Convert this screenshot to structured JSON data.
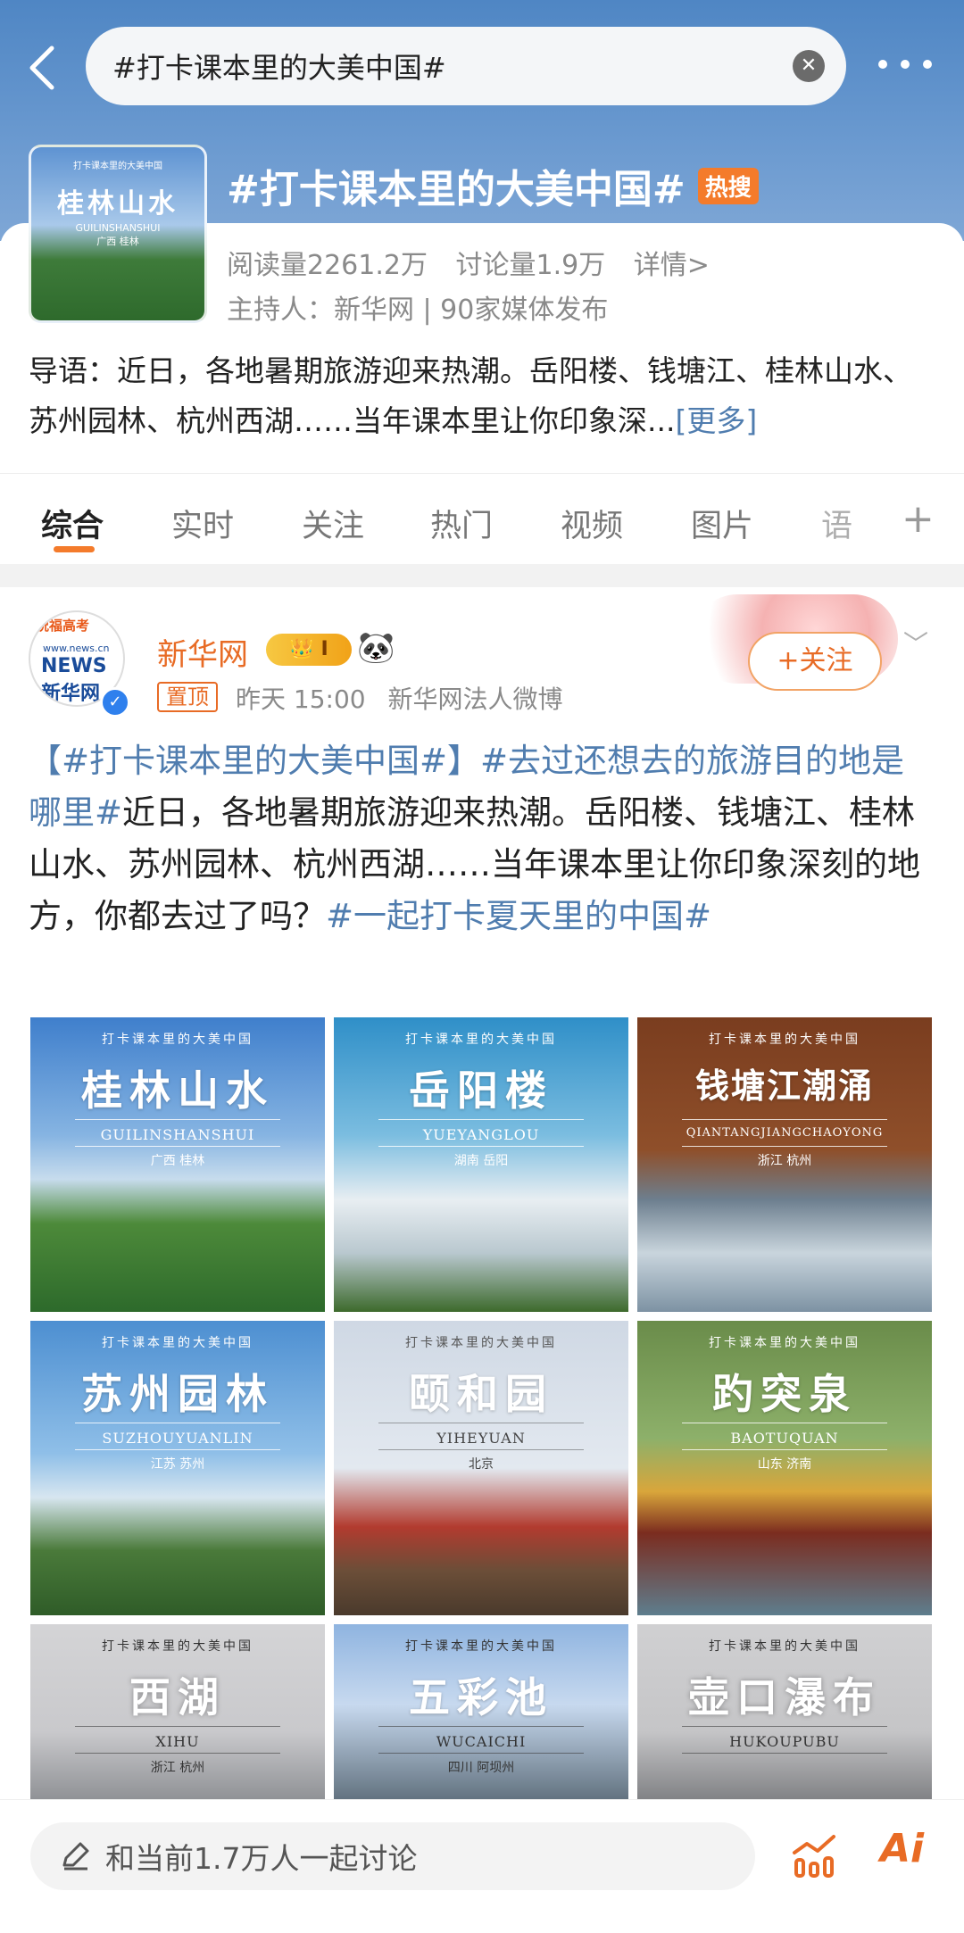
{
  "search": {
    "query": "#打卡课本里的大美中国#"
  },
  "topic": {
    "title": "#打卡课本里的大美中国#",
    "hot_badge": "热搜",
    "reads": "阅读量2261.2万",
    "discussions": "讨论量1.9万",
    "details": "详情>",
    "host": "主持人：新华网 | 90家媒体发布",
    "intro": "导语：近日，各地暑期旅游迎来热潮。岳阳楼、钱塘江、桂林山水、苏州园林、杭州西湖……当年课本里让你印象深...",
    "more_link": "[更多]",
    "cover": {
      "small": "打卡课本里的大美中国",
      "title": "桂林山水",
      "pinyin": "GUILINSHANSHUI",
      "loc": "广西 桂林"
    }
  },
  "tabs": [
    "综合",
    "实时",
    "关注",
    "热门",
    "视频",
    "图片",
    "语"
  ],
  "post": {
    "avatar": {
      "badge": "祝福高考",
      "site": "www.news.cn",
      "logo": "NEWS 新华网"
    },
    "user": "新华网",
    "level": "I",
    "pin": "置顶",
    "time": "昨天 15:00",
    "source": "新华网法人微博",
    "follow": "+关注",
    "text": {
      "tag1": "【#打卡课本里的大美中国#】",
      "tag2": "#去过还想去的旅游目的地是哪里#",
      "body": "近日，各地暑期旅游迎来热潮。岳阳楼、钱塘江、桂林山水、苏州园林、杭州西湖……当年课本里让你印象深刻的地方，你都去过了吗？",
      "tag3": "#一起打卡夏天里的中国#"
    },
    "images": [
      {
        "small": "打卡课本里的大美中国",
        "title": "桂林山水",
        "pinyin": "GUILINSHANSHUI",
        "loc": "广西 桂林"
      },
      {
        "small": "打卡课本里的大美中国",
        "title": "岳阳楼",
        "pinyin": "YUEYANGLOU",
        "loc": "湖南 岳阳"
      },
      {
        "small": "打卡课本里的大美中国",
        "title": "钱塘江潮涌",
        "pinyin": "QIANTANGJIANGCHAOYONG",
        "loc": "浙江 杭州"
      },
      {
        "small": "打卡课本里的大美中国",
        "title": "苏州园林",
        "pinyin": "SUZHOUYUANLIN",
        "loc": "江苏 苏州"
      },
      {
        "small": "打卡课本里的大美中国",
        "title": "颐和园",
        "pinyin": "YIHEYUAN",
        "loc": "北京"
      },
      {
        "small": "打卡课本里的大美中国",
        "title": "趵突泉",
        "pinyin": "BAOTUQUAN",
        "loc": "山东 济南"
      },
      {
        "small": "打卡课本里的大美中国",
        "title": "西湖",
        "pinyin": "XIHU",
        "loc": "浙江 杭州"
      },
      {
        "small": "打卡课本里的大美中国",
        "title": "五彩池",
        "pinyin": "WUCAICHI",
        "loc": "四川 阿坝州"
      },
      {
        "small": "打卡课本里的大美中国",
        "title": "壶口瀑布",
        "pinyin": "HUKOUPUBU",
        "loc": ""
      }
    ]
  },
  "bottom": {
    "comment_placeholder": "和当前1.7万人一起讨论",
    "ai_label": "Ai"
  },
  "colors": {
    "accent": "#f47b2b",
    "link": "#507daf",
    "header": "#5b8ecb"
  }
}
